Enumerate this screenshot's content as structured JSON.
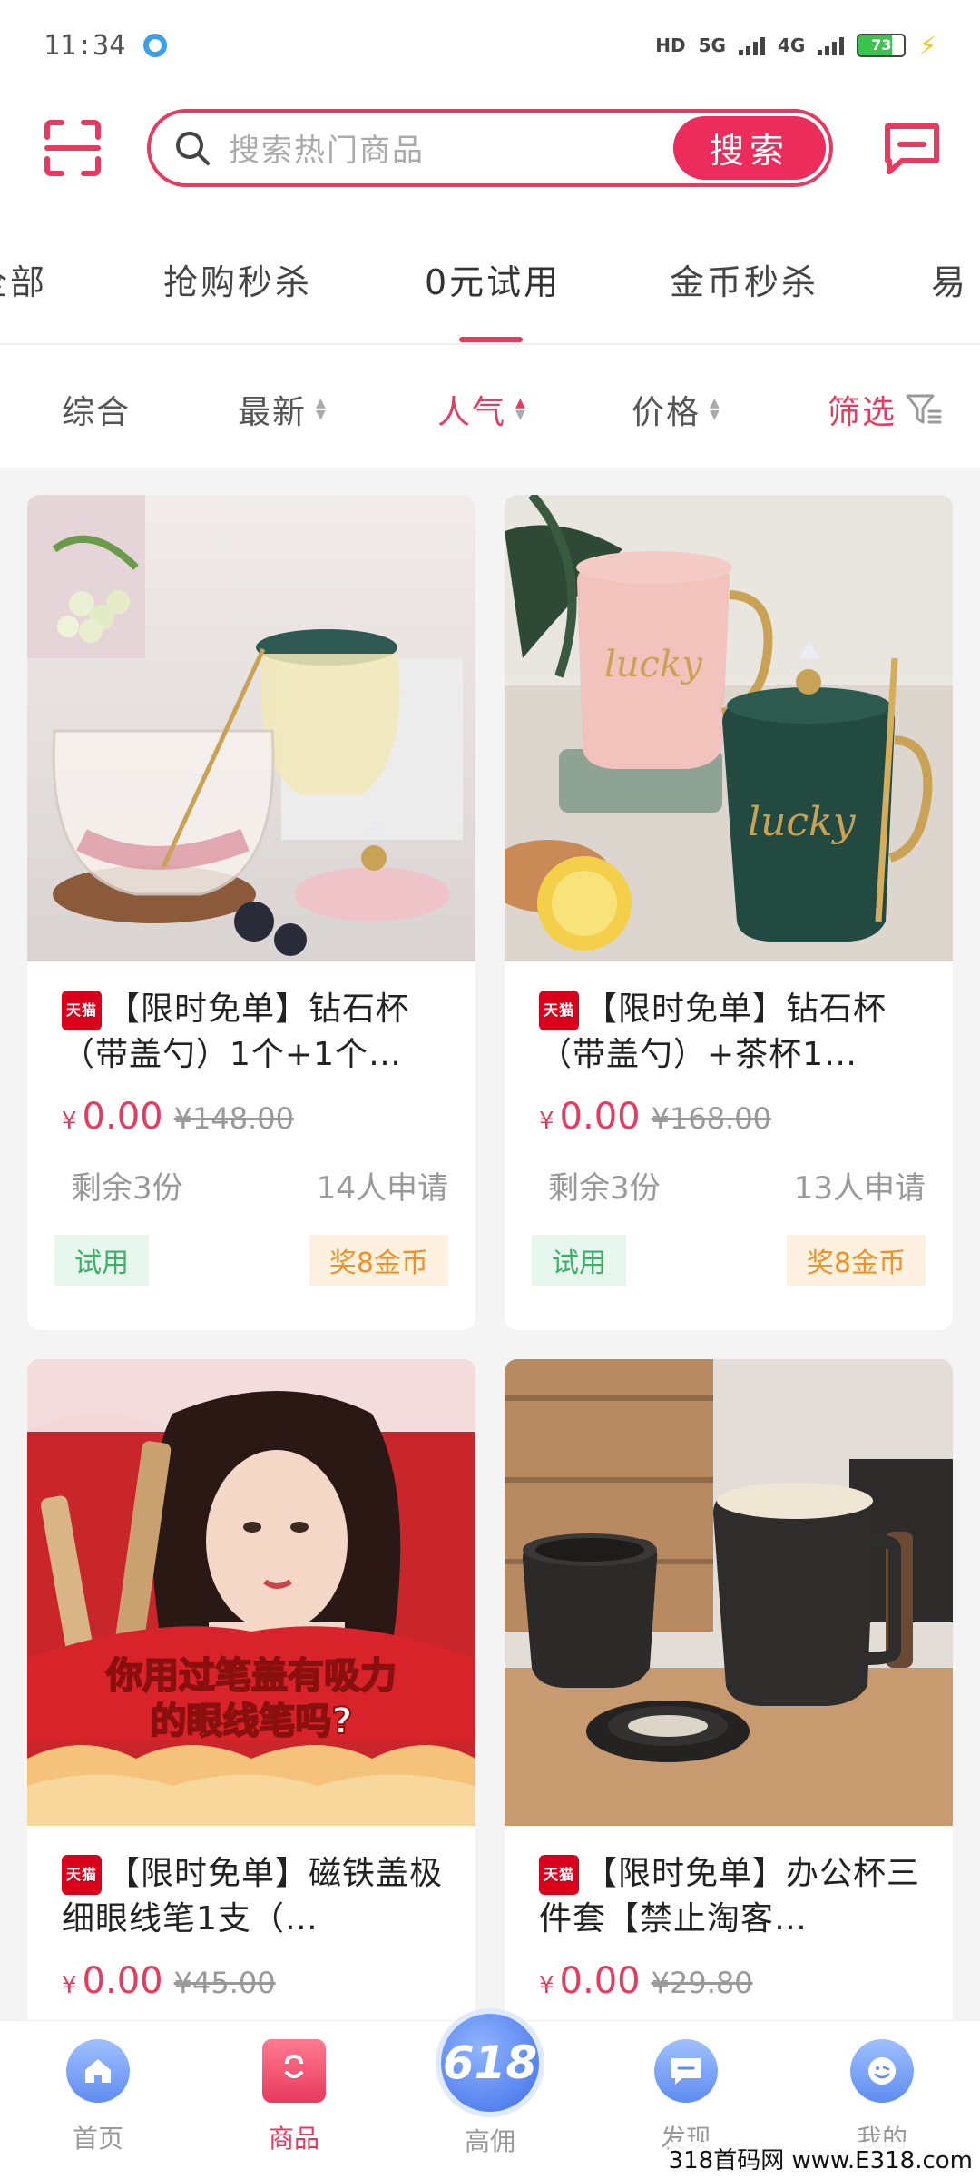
{
  "status_bar": {
    "time": "11:34",
    "network": "5G",
    "network2": "4G",
    "hd": "HD",
    "battery": "73",
    "battery_level": 73
  },
  "search": {
    "placeholder": "搜索热门商品",
    "button_label": "搜索"
  },
  "categories": [
    "全部",
    "抢购秒杀",
    "0元试用",
    "金币秒杀",
    "易"
  ],
  "active_category": "0元试用",
  "sort": {
    "items": [
      "综合",
      "最新",
      "人气",
      "价格"
    ],
    "active": "人气",
    "filter_label": "筛选"
  },
  "products": [
    {
      "badge": "天猫",
      "title": "【限时免单】钻石杯（带盖勺）1个+1个…",
      "price": "0.00",
      "currency": "¥",
      "original": "¥148.00",
      "remaining": "剩余3份",
      "applicants": "14人申请",
      "tag_trial": "试用",
      "tag_coin": "奖8金币"
    },
    {
      "badge": "天猫",
      "title": "【限时免单】钻石杯（带盖勺）+茶杯1…",
      "price": "0.00",
      "currency": "¥",
      "original": "¥168.00",
      "remaining": "剩余3份",
      "applicants": "13人申请",
      "tag_trial": "试用",
      "tag_coin": "奖8金币"
    },
    {
      "badge": "天猫",
      "title": "【限时免单】磁铁盖极细眼线笔1支（…",
      "price": "0.00",
      "currency": "¥",
      "original": "¥45.00",
      "image_text": "你用过笔盖有吸力的眼线笔吗?"
    },
    {
      "badge": "天猫",
      "title": "【限时免单】办公杯三件套【禁止淘客…",
      "price": "0.00",
      "currency": "¥",
      "original": "¥29.80"
    }
  ],
  "bottom_nav": {
    "items": [
      "首页",
      "商品",
      "高佣",
      "发现",
      "我的"
    ],
    "active": "商品",
    "center_badge": "618"
  },
  "colors": {
    "accent": "#e8395e",
    "trial_green": "#3fae6a",
    "coin_orange": "#f0902a"
  },
  "watermark": "318首码网 www.E318.com"
}
